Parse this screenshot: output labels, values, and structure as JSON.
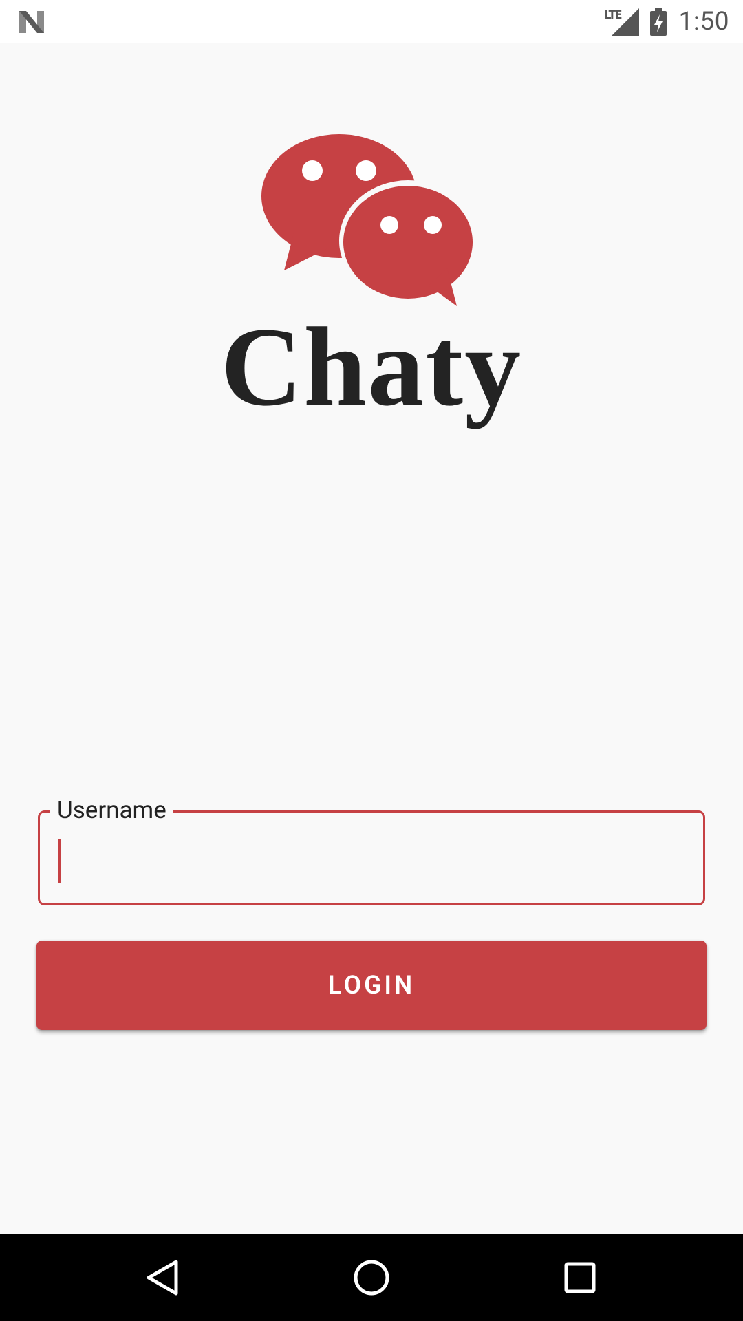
{
  "status_bar": {
    "time": "1:50",
    "network_label": "LTE",
    "icons": [
      "android-n-icon",
      "signal-icon",
      "battery-charging-icon"
    ]
  },
  "app": {
    "name": "Chaty",
    "logo_icon": "chat-bubbles-icon",
    "brand_color": "#c64144"
  },
  "login_form": {
    "username_label": "Username",
    "username_value": "",
    "login_button_label": "LOGIN"
  },
  "nav_bar": {
    "icons": [
      "back-icon",
      "home-icon",
      "recents-icon"
    ]
  }
}
